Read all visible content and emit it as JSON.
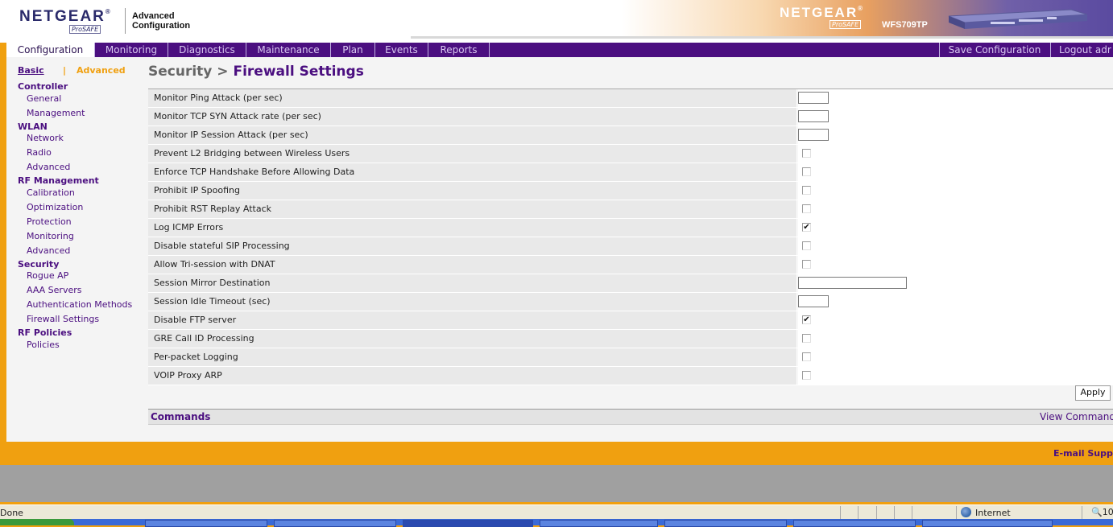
{
  "header": {
    "logo": "NETGEAR",
    "logo_sub": "ProSAFE",
    "app_title_1": "Advanced",
    "app_title_2": "Configuration",
    "logo_right": "NETGEAR",
    "logo_right_sub": "ProSAFE",
    "model": "WFS709TP"
  },
  "nav": {
    "tabs": [
      {
        "label": "Configuration"
      },
      {
        "label": "Monitoring"
      },
      {
        "label": "Diagnostics"
      },
      {
        "label": "Maintenance"
      },
      {
        "label": "Plan"
      },
      {
        "label": "Events"
      },
      {
        "label": "Reports"
      }
    ],
    "save": "Save Configuration",
    "logout": "Logout adr"
  },
  "sidebar": {
    "basic": "Basic",
    "separator": "|",
    "advanced": "Advanced",
    "sections": [
      {
        "title": "Controller",
        "items": [
          "General",
          "Management"
        ]
      },
      {
        "title": "WLAN",
        "items": [
          "Network",
          "Radio",
          "Advanced"
        ]
      },
      {
        "title": "RF Management",
        "items": [
          "Calibration",
          "Optimization",
          "Protection",
          "Monitoring",
          "Advanced"
        ]
      },
      {
        "title": "Security",
        "items": [
          "Rogue AP",
          "AAA Servers",
          "Authentication Methods",
          "Firewall Settings"
        ]
      },
      {
        "title": "RF Policies",
        "items": [
          "Policies"
        ]
      }
    ]
  },
  "page": {
    "crumb": "Security >",
    "title": "Firewall Settings"
  },
  "settings": [
    {
      "label": "Monitor Ping Attack (per sec)",
      "type": "text",
      "value": ""
    },
    {
      "label": "Monitor TCP SYN Attack rate (per sec)",
      "type": "text",
      "value": ""
    },
    {
      "label": "Monitor IP Session Attack (per sec)",
      "type": "text",
      "value": ""
    },
    {
      "label": "Prevent L2 Bridging between Wireless Users",
      "type": "checkbox",
      "checked": false
    },
    {
      "label": "Enforce TCP Handshake Before Allowing Data",
      "type": "checkbox",
      "checked": false
    },
    {
      "label": "Prohibit IP Spoofing",
      "type": "checkbox",
      "checked": false
    },
    {
      "label": "Prohibit RST Replay Attack",
      "type": "checkbox",
      "checked": false
    },
    {
      "label": "Log ICMP Errors",
      "type": "checkbox",
      "checked": true
    },
    {
      "label": "Disable stateful SIP Processing",
      "type": "checkbox",
      "checked": false
    },
    {
      "label": "Allow Tri-session with DNAT",
      "type": "checkbox",
      "checked": false
    },
    {
      "label": "Session Mirror Destination",
      "type": "text-wide",
      "value": ""
    },
    {
      "label": "Session Idle Timeout (sec)",
      "type": "text",
      "value": ""
    },
    {
      "label": "Disable FTP server",
      "type": "checkbox",
      "checked": true
    },
    {
      "label": "GRE Call ID Processing",
      "type": "checkbox",
      "checked": false
    },
    {
      "label": "Per-packet Logging",
      "type": "checkbox",
      "checked": false
    },
    {
      "label": "VOIP Proxy ARP",
      "type": "checkbox",
      "checked": false
    }
  ],
  "apply": "Apply",
  "commands": {
    "label": "Commands",
    "view": "View Command"
  },
  "footer": {
    "email": "E-mail Supp"
  },
  "statusbar": {
    "done": "Done",
    "zone": "Internet",
    "zoom": "10"
  },
  "colors": {
    "nav_purple": "#4b0f80",
    "accent_orange": "#f0a010"
  }
}
